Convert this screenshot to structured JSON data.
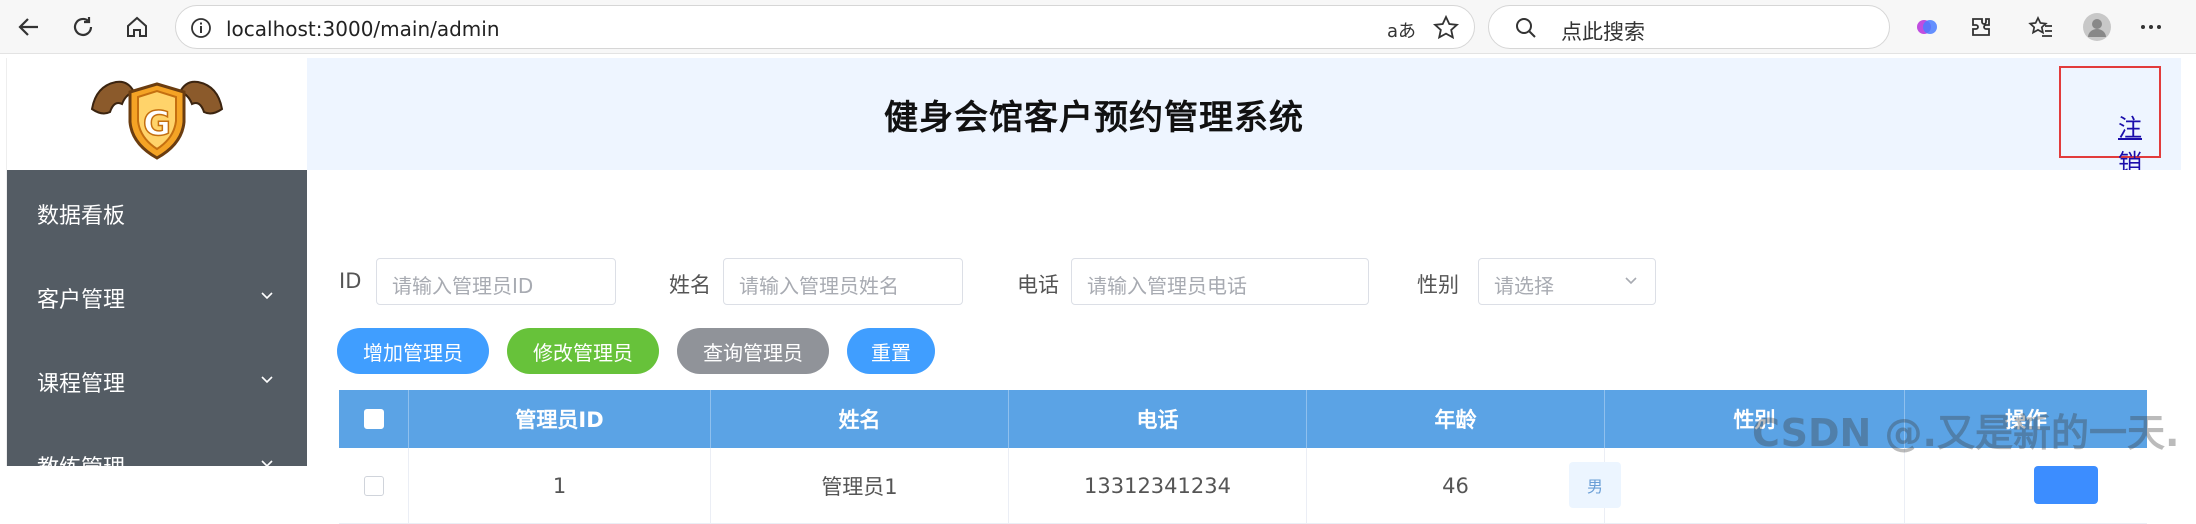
{
  "browser": {
    "url": "localhost:3000/main/admin",
    "reader_label": "aあ",
    "search_placeholder": "点此搜索"
  },
  "header": {
    "title": "健身会馆客户预约管理系统",
    "logout_label": "注销",
    "logo_letter": "G"
  },
  "sidebar": {
    "items": [
      {
        "label": "数据看板",
        "has_children": false
      },
      {
        "label": "客户管理",
        "has_children": true
      },
      {
        "label": "课程管理",
        "has_children": true
      },
      {
        "label": "教练管理",
        "has_children": true
      }
    ]
  },
  "filters": {
    "id_label": "ID",
    "id_placeholder": "请输入管理员ID",
    "name_label": "姓名",
    "name_placeholder": "请输入管理员姓名",
    "phone_label": "电话",
    "phone_placeholder": "请输入管理员电话",
    "gender_label": "性别",
    "gender_placeholder": "请选择"
  },
  "actions": {
    "add": "增加管理员",
    "edit": "修改管理员",
    "query": "查询管理员",
    "reset": "重置"
  },
  "table": {
    "columns": [
      "管理员ID",
      "姓名",
      "电话",
      "年龄",
      "性别",
      "操作"
    ],
    "rows": [
      {
        "id": "1",
        "name": "管理员1",
        "phone": "13312341234",
        "age": "46",
        "gender": "男"
      }
    ]
  },
  "watermark": "CSDN @.又是新的一天.",
  "colors": {
    "header_bg": "#eef5ff",
    "sidebar_bg": "#545c64",
    "table_header_bg": "#5ba3e5",
    "btn_blue": "#409eff",
    "btn_green": "#67c23a",
    "btn_gray": "#909399",
    "logout_border": "#e23b3b"
  }
}
